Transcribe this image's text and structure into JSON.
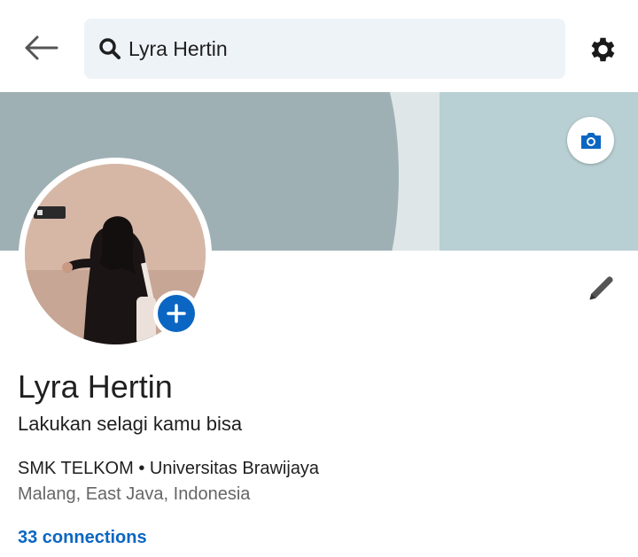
{
  "search": {
    "value": "Lyra Hertin"
  },
  "icons": {
    "back": "back-arrow-icon",
    "search": "search-icon",
    "settings": "gear-icon",
    "camera": "camera-icon",
    "add": "plus-icon",
    "edit": "pencil-icon"
  },
  "profile": {
    "name": "Lyra Hertin",
    "headline": "Lakukan selagi kamu bisa",
    "education": "SMK TELKOM • Universitas Brawijaya",
    "location": "Malang, East Java, Indonesia",
    "connections": "33 connections"
  },
  "colors": {
    "accent": "#0a66c2",
    "banner": "#9fb0b5",
    "search_bg": "#eef3f8"
  }
}
